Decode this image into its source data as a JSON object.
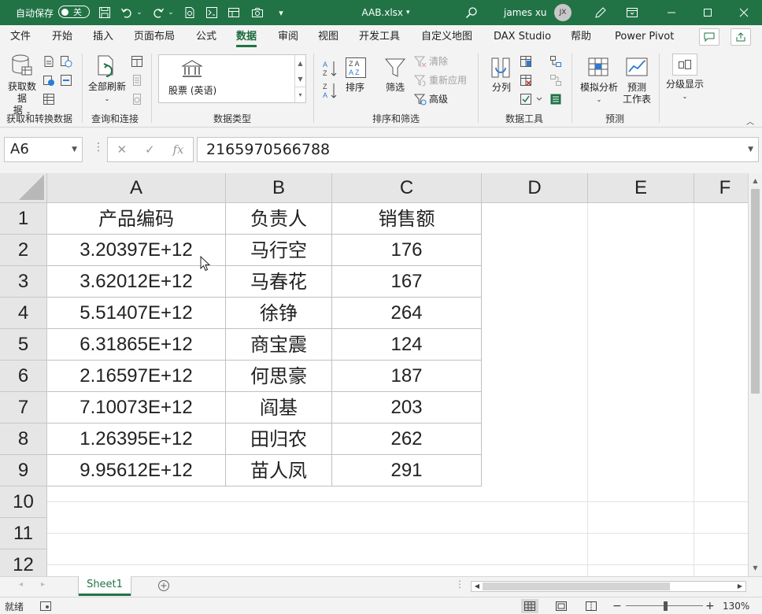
{
  "titlebar": {
    "autosave_label": "自动保存",
    "autosave_state": "关",
    "file_name": "AAB.xlsx",
    "user_name": "james xu",
    "user_initials": "JX"
  },
  "tabs": [
    "文件",
    "开始",
    "插入",
    "页面布局",
    "公式",
    "数据",
    "审阅",
    "视图",
    "开发工具",
    "自定义地图",
    "DAX Studio",
    "帮助",
    "Power Pivot"
  ],
  "active_tab": "数据",
  "ribbon": {
    "get_data": "获取数据",
    "get_data_2": "据",
    "group_get_transform": "获取和转换数据",
    "refresh_all": "全部刷新",
    "group_queries": "查询和连接",
    "stocks": "股票 (英语)",
    "group_data_types": "数据类型",
    "sort": "排序",
    "filter": "筛选",
    "clear": "清除",
    "reapply": "重新应用",
    "advanced": "高级",
    "group_sort_filter": "排序和筛选",
    "text_to_columns": "分列",
    "group_data_tools": "数据工具",
    "what_if": "模拟分析",
    "forecast_sheet_1": "预测",
    "forecast_sheet_2": "工作表",
    "group_forecast": "预测",
    "outline": "分级显示"
  },
  "formula_bar": {
    "name_box": "A6",
    "value": "2165970566788"
  },
  "columns": [
    "A",
    "B",
    "C",
    "D",
    "E",
    "F"
  ],
  "rows": [
    "1",
    "2",
    "3",
    "4",
    "5",
    "6",
    "7",
    "8",
    "9",
    "10",
    "11",
    "12"
  ],
  "table": {
    "header": [
      "产品编码",
      "负责人",
      "销售额"
    ],
    "rows": [
      [
        "3.20397E+12",
        "马行空",
        "176"
      ],
      [
        "3.62012E+12",
        "马春花",
        "167"
      ],
      [
        "5.51407E+12",
        "徐铮",
        "264"
      ],
      [
        "6.31865E+12",
        "商宝震",
        "124"
      ],
      [
        "2.16597E+12",
        "何思豪",
        "187"
      ],
      [
        "7.10073E+12",
        "阎基",
        "203"
      ],
      [
        "1.26395E+12",
        "田归农",
        "262"
      ],
      [
        "9.95612E+12",
        "苗人凤",
        "291"
      ]
    ]
  },
  "sheet": {
    "tab_name": "Sheet1"
  },
  "status": {
    "ready": "就绪",
    "zoom": "130%"
  },
  "colors": {
    "excel_green": "#217346",
    "grid_border": "#c0c0c0",
    "header_bg": "#e6e6e6"
  }
}
